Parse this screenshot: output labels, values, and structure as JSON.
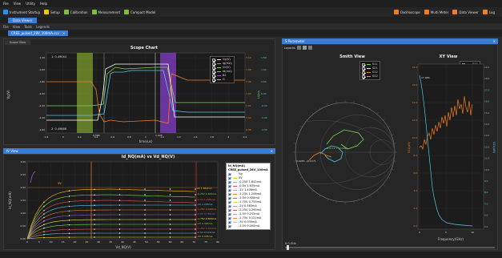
{
  "menu": [
    "File",
    "View",
    "Utility",
    "Help"
  ],
  "toolbar": {
    "left": [
      {
        "label": "Instrument Startup",
        "color": "#1e90ff"
      },
      {
        "label": "Setup",
        "color": "#f5c400"
      },
      {
        "label": "Calibration",
        "color": "#7dbf3a"
      },
      {
        "label": "Measurement",
        "color": "#7dbf3a"
      },
      {
        "label": "Compact Model",
        "color": "#7dbf3a"
      }
    ],
    "right": [
      {
        "label": "Oscilloscope",
        "color": "#f07d1e"
      },
      {
        "label": "Multi Meter",
        "color": "#f07d1e"
      },
      {
        "label": "Data Viewer",
        "color": "#f07d1e"
      },
      {
        "label": "Log",
        "color": "#f07d1e"
      }
    ]
  },
  "doc_tab": "Data Viewer",
  "submenu": [
    "File",
    "View",
    "Tools",
    "Legends"
  ],
  "file_tab": "CREE_pulsed_28V_100mA.csv",
  "scope": {
    "subtab": "Scope View",
    "title": "Scope Chart",
    "xlabel": "time(us)",
    "ylabel_left": "Vg(V)",
    "ylabel_right1": "Ig(mA)",
    "ylabel_right2": "Vd(V)",
    "ylabel_right3": "Id(mA)",
    "readout_top": "1: 0.49044",
    "readout_bottom": "2: 0.49886",
    "marker_a": "0.568",
    "marker_b": "1.028",
    "legend": [
      {
        "label": "Vg(V)",
        "color": "#ffffff"
      },
      {
        "label": "Ig(mA)",
        "color": "#f07d1e"
      },
      {
        "label": "Vd(V)",
        "color": "#7dd35a"
      },
      {
        "label": "Id(mA)",
        "color": "#50c8e6"
      },
      {
        "label": "B2",
        "color": "#9b59d6"
      },
      {
        "label": "G",
        "color": "#d4c200"
      }
    ],
    "yticks_left": [
      "-1.40",
      "-1.60",
      "-1.80",
      "-2.00",
      "-2.20",
      "-2.40",
      "-2.60"
    ],
    "yticks_r1": [
      "7.10",
      "7.08",
      "7.06",
      "7.04",
      "7.02",
      "7.00",
      "6.98"
    ],
    "yticks_r2": [
      "60",
      "50",
      "40",
      "30",
      "20",
      "10",
      "0"
    ],
    "yticks_r3": [
      "1.50",
      "1.00",
      "0.50",
      "0.00",
      "-0.50",
      "-1.00",
      "-1.50"
    ],
    "xticks": [
      "0.2",
      "0",
      "0.2",
      "0.4",
      "0.6",
      "0.8",
      "1",
      "1.2",
      "1.4",
      "1.6",
      "1.8",
      "2",
      "2.2"
    ]
  },
  "iv": {
    "subtab": "IV View",
    "title": "Id_NQ(mA) vs Vd_NQ(V)",
    "xlabel": "Vd_NQ(V)",
    "ylabel": "Id_NQ(mA)",
    "xticks": [
      "0",
      "5",
      "10",
      "15",
      "20",
      "25",
      "30",
      "35",
      "40",
      "45",
      "50",
      "55",
      "60",
      "65",
      "70",
      "75",
      "80"
    ],
    "yticks": [
      "3.00",
      "2.50",
      "2.00",
      "1.50",
      "1.00",
      "0.50",
      "0.00"
    ],
    "legend_title": "Id_NQ(mA)",
    "legend_subtitle": "CREE_pulsed_28V_100mA",
    "legend": [
      {
        "label": "Vg",
        "color": "#ffffff"
      },
      {
        "label": "0V",
        "color": "#f5c400"
      },
      {
        "label": "-0.25V 1.842mA",
        "color": "#7dd35a"
      },
      {
        "label": "-0.5V 1.635mA",
        "color": "#e05050"
      },
      {
        "label": "-1V 1.406mA",
        "color": "#50c8e6"
      },
      {
        "label": "-1.25V 1.208mA",
        "color": "#f07d1e"
      },
      {
        "label": "-1.5V 0.928mA",
        "color": "#9b59d6"
      },
      {
        "label": "-1.75V 0.755mA",
        "color": "#e6e650"
      },
      {
        "label": "-2V 0.563mA",
        "color": "#7dd35a"
      },
      {
        "label": "-2.25V 0.395mA",
        "color": "#e05050"
      },
      {
        "label": "-2.5V 0.252mA",
        "color": "#50c8e6"
      },
      {
        "label": "-2.75V 0.122mA",
        "color": "#f07d1e"
      },
      {
        "label": "-3V 0.035mA",
        "color": "#f5c400"
      },
      {
        "label": "-3.5V 0.000mA",
        "color": "#ffffff"
      }
    ],
    "curve_labels": [
      "0V 1.842mA",
      "-0.25V 1.635mA",
      "-0.5V 1.406mA",
      "-1V 1.208mA",
      "-1.25V 0.928mA",
      "-1.5V 0.755mA",
      "-1.75V 0.563mA",
      "-2V 0.395mA",
      "-2.25V 0.252mA",
      "-2.5V 0.122mA",
      "-3V 0.035mA"
    ],
    "marker_top": "5V"
  },
  "sparams": {
    "header": "S Parameter",
    "layouts_label": "Layouts",
    "smith_title": "Smith View",
    "xy_title": "XY View",
    "smith_legend": [
      {
        "label": "S11",
        "color": "#7dd35a"
      },
      {
        "label": "S21",
        "color": "#ffffff"
      },
      {
        "label": "S12",
        "color": "#f07d1e"
      },
      {
        "label": "S22",
        "color": "#50c8e6"
      }
    ],
    "xy_legend": [
      {
        "label": "S11",
        "color": "#ffffff"
      },
      {
        "label": "S21",
        "color": "#f07d1e"
      },
      {
        "label": "S12",
        "color": "#f5c400"
      },
      {
        "label": "S22",
        "color": "#50c8e6"
      }
    ],
    "smith_annot": "0.0265 - j0.0171",
    "smith_annot2": "0.2711 + j0.5481",
    "xy_xlabel": "Frequency(GHz)",
    "xy_ylabel": "S11(dB)",
    "xy_ylabel_right": "S21(dB)",
    "xy_annot": "17.986",
    "xy_yticks": [
      "18.0",
      "16.0",
      "14.0",
      "12.0",
      "10.0",
      "8.0",
      "6.0",
      "4.0",
      "2.0",
      "0.0"
    ],
    "xy_yticks_r": [
      "19.0",
      "18.0",
      "17.0",
      "16.0",
      "15.0",
      "14.0",
      "13.0",
      "12.0",
      "11.0",
      "10.0",
      "9.0",
      "8.0",
      "7.0",
      "6.0",
      "5.0"
    ],
    "xy_xticks": [
      "0",
      "5",
      "10"
    ],
    "slider_label": "0.0 GHz"
  }
}
